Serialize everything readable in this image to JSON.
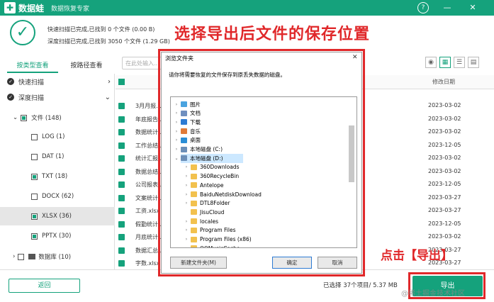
{
  "app": {
    "brand": "数据蛙",
    "subtitle": "数据恢复专家",
    "help_glyph": "?",
    "minimize_glyph": "—",
    "close_glyph": "✕"
  },
  "scan": {
    "quick_status": "快速扫描已完成,已找到 0 个文件 (0.00 B)",
    "deep_status": "深度扫描已完成,已找到 3050 个文件 (1.29 GB)"
  },
  "annotations": {
    "title": "选择导出后文件的保存位置",
    "click_hint": "点击【导出】"
  },
  "tabs": {
    "by_type": "按类型查看",
    "by_path": "按路径查看"
  },
  "search": {
    "placeholder": "在此处输入..."
  },
  "sidebar": {
    "quick_scan": "快速扫描",
    "deep_scan": "深度扫描",
    "items": [
      {
        "label": "文件 (148)"
      },
      {
        "label": "LOG (1)"
      },
      {
        "label": "DAT (1)"
      },
      {
        "label": "TXT (18)"
      },
      {
        "label": "DOCX (62)"
      },
      {
        "label": "XLSX (36)"
      },
      {
        "label": "PPTX (30)"
      },
      {
        "label": "数据库 (10)"
      }
    ]
  },
  "table": {
    "date_header": "修改日期",
    "rows": [
      {
        "name": "3月月报...",
        "date": "2023-03-02"
      },
      {
        "name": "年底报告...",
        "date": "2023-03-02"
      },
      {
        "name": "数据统计...",
        "date": "2023-03-02"
      },
      {
        "name": "工作总结...",
        "date": "2023-12-05"
      },
      {
        "name": "统计汇报...",
        "date": "2023-03-02"
      },
      {
        "name": "数据总结...",
        "date": "2023-03-02"
      },
      {
        "name": "公司报表...",
        "date": "2023-12-05"
      },
      {
        "name": "文案统计...",
        "date": "2023-03-27"
      },
      {
        "name": "工资.xlsx",
        "date": "2023-03-27"
      },
      {
        "name": "假勤统计...",
        "date": "2023-12-05"
      },
      {
        "name": "月底统计...",
        "date": "2023-03-02"
      },
      {
        "name": "数据汇总...",
        "date": "2023-03-27"
      },
      {
        "name": "字数.xlsx",
        "date": "2023-03-27"
      }
    ]
  },
  "dialog": {
    "title": "浏览文件夹",
    "prompt": "请你将需要恢复的文件保存到原丢失数据的磁盘。",
    "close_glyph": "✕",
    "tree": [
      {
        "label": "图片"
      },
      {
        "label": "文档"
      },
      {
        "label": "下载"
      },
      {
        "label": "音乐"
      },
      {
        "label": "桌面"
      },
      {
        "label": "本地磁盘 (C:)"
      },
      {
        "label": "本地磁盘 (D:)"
      },
      {
        "label": "360Downloads"
      },
      {
        "label": "360RecycleBin"
      },
      {
        "label": "Antelope"
      },
      {
        "label": "BaiduNetdiskDownload"
      },
      {
        "label": "DTL8Folder"
      },
      {
        "label": "JisuCloud"
      },
      {
        "label": "locales"
      },
      {
        "label": "Program Files"
      },
      {
        "label": "Program Files (x86)"
      },
      {
        "label": "QQMusicCache"
      }
    ],
    "new_folder": "新建文件夹(M)",
    "ok": "确定",
    "cancel": "取消"
  },
  "footer": {
    "back": "返回",
    "selected": "已选择 37个项目/ 5.37 MB",
    "export": "导出",
    "watermark": "@稀土掘金技术社区"
  },
  "colors": {
    "brand": "#15a27c",
    "annotation": "#e0282a"
  }
}
